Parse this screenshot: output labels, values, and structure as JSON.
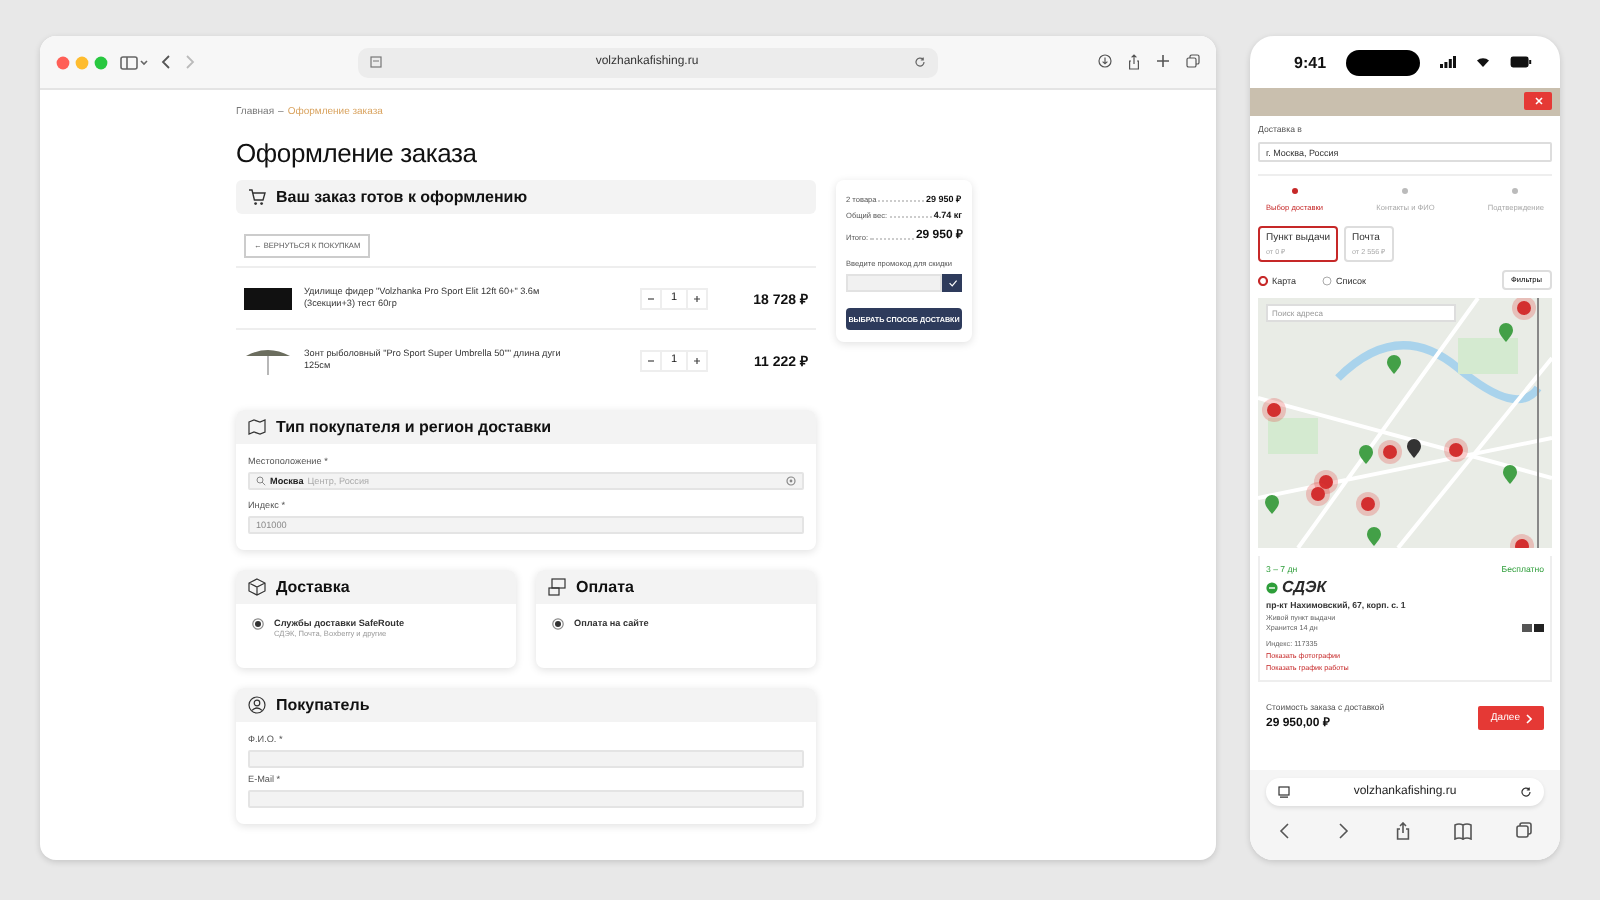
{
  "browser": {
    "url": "volzhankafishing.ru"
  },
  "breadcrumb": [
    {
      "label": "Главная",
      "current": false
    },
    {
      "label": "Оформление заказа",
      "current": true
    }
  ],
  "breadcrumb_separator": "–",
  "title": "Оформление заказа",
  "order": {
    "heading": "Ваш заказ готов к оформлению",
    "back_button": "← ВЕРНУТЬСЯ К ПОКУПКАМ",
    "items": [
      {
        "name": "Удилище фидер \"Volzhanka Pro Sport Elit 12ft 60+\" 3.6м (3секции+3) тест 60гр",
        "qty": "1",
        "price": "18 728 ₽"
      },
      {
        "name": "Зонт рыболовный \"Pro Sport Super Umbrella 50\"\" длина дуги 125см",
        "qty": "1",
        "price": "11 222 ₽"
      }
    ]
  },
  "summary": {
    "rows": [
      {
        "label": "2 товара",
        "value": "29 950 ₽",
        "kind": "plain"
      },
      {
        "label": "Общий вес:",
        "value": "4.74 кг",
        "kind": "plain"
      },
      {
        "label": "Итого:",
        "value": "29 950 ₽",
        "kind": "total"
      }
    ],
    "promo_label": "Введите промокод для скидки",
    "submit": "ВЫБРАТЬ СПОСОБ ДОСТАВКИ"
  },
  "region": {
    "heading": "Тип покупателя и регион доставки",
    "location_label": "Местоположение *",
    "location_value": "Москва",
    "location_hint": "Центр, Россия",
    "index_label": "Индекс *",
    "index_value": "101000"
  },
  "delivery": {
    "heading": "Доставка",
    "options": [
      {
        "title": "Службы доставки SafeRoute",
        "subtitle": "СДЭК, Почта, Boxberry и другие",
        "selected": true
      }
    ]
  },
  "payment": {
    "heading": "Оплата",
    "options": [
      {
        "title": "Оплата на сайте",
        "selected": true
      }
    ]
  },
  "buyer": {
    "heading": "Покупатель",
    "fields": [
      {
        "label": "Ф.И.О. *"
      },
      {
        "label": "E-Mail *"
      }
    ]
  },
  "phone": {
    "time": "9:41",
    "deliver_to_label": "Доставка в",
    "deliver_to_value": "г. Москва, Россия",
    "steps": [
      {
        "label": "Выбор доставки",
        "selected": true
      },
      {
        "label": "Контакты и ФИО",
        "selected": false
      },
      {
        "label": "Подтверждение",
        "selected": false
      }
    ],
    "tabs": [
      {
        "label": "Пункт выдачи",
        "sub": "от 0 ₽",
        "selected": true
      },
      {
        "label": "Почта",
        "sub": "от 2 556 ₽",
        "selected": false
      }
    ],
    "views": [
      {
        "label": "Карта",
        "selected": true
      },
      {
        "label": "Список",
        "selected": false
      }
    ],
    "filters": "Фильтры",
    "map_search_placeholder": "Поиск адреса",
    "point": {
      "days": "3 – 7 дн",
      "cost": "Бесплатно",
      "carrier": "СДЭК",
      "address": "пр-кт Нахимовский, 67, корп. с. 1",
      "details": [
        "Живой пункт выдачи",
        "Хранится 14 дн"
      ],
      "index": "Индекс: 117335",
      "links": [
        "Показать фотографии",
        "Показать график работы"
      ]
    },
    "total_label": "Стоимость заказа с доставкой",
    "total_value": "29 950,00 ₽",
    "next": "Далее",
    "url": "volzhankafishing.ru"
  }
}
